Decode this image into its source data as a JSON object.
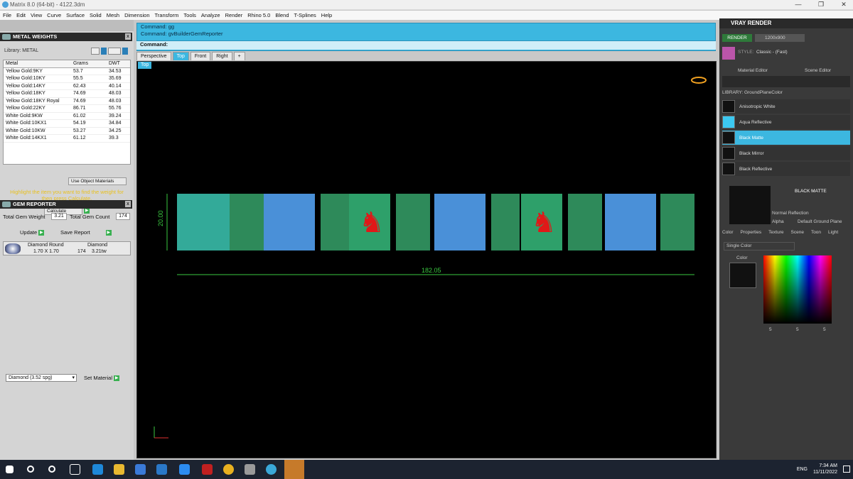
{
  "window": {
    "title": "Matrix 8.0 (64-bit) - 4122.3dm",
    "min": "—",
    "max": "❐",
    "close": "✕"
  },
  "menu": [
    "File",
    "Edit",
    "View",
    "Curve",
    "Surface",
    "Solid",
    "Mesh",
    "Dimension",
    "Transform",
    "Tools",
    "Analyze",
    "Render",
    "Rhino 5.0",
    "Blend",
    "T-Splines",
    "Help"
  ],
  "metal_weights": {
    "title": "METAL WEIGHTS",
    "library_label": "Library: METAL",
    "columns": [
      "Metal",
      "Grams",
      "DWT"
    ],
    "rows": [
      [
        "Yellow Gold:9KY",
        "53.7",
        "34.53"
      ],
      [
        "Yellow Gold:10KY",
        "55.5",
        "35.69"
      ],
      [
        "Yellow Gold:14KY",
        "62.43",
        "40.14"
      ],
      [
        "Yellow Gold:18KY",
        "74.69",
        "48.03"
      ],
      [
        "Yellow Gold:18KY Royal",
        "74.69",
        "48.03"
      ],
      [
        "Yellow Gold:22KY",
        "86.71",
        "55.76"
      ],
      [
        "White Gold:9KW",
        "61.02",
        "39.24"
      ],
      [
        "White Gold:10KX1",
        "54.19",
        "34.84"
      ],
      [
        "White Gold:10KW",
        "53.27",
        "34.25"
      ],
      [
        "White Gold:14KX1",
        "61.12",
        "39.3"
      ]
    ],
    "use_object_materials": "Use Object Materials",
    "hint": "Highlight the item you want to find the weight for then press Calculate.",
    "calculate": "Calculate"
  },
  "gem_reporter": {
    "title": "GEM REPORTER",
    "total_weight_label": "Total Gem Weight",
    "total_weight": "3.21",
    "total_count_label": "Total Gem Count",
    "total_count": "174",
    "update": "Update",
    "save_report": "Save Report",
    "gem_type": "Diamond Round",
    "gem_size": "1.70 X 1.70",
    "gem_material": "Diamond",
    "gem_count": "174",
    "gem_ctw": "3.21tw",
    "material_select": "Diamond   (3.52 spg)",
    "set_material": "Set Material"
  },
  "command": {
    "line1": "Command: gg",
    "line2": "Command: gvBuilderGemReporter",
    "prompt": "Command:"
  },
  "viewport_tabs": [
    "Perspective",
    "Top",
    "Front",
    "Right",
    "+"
  ],
  "viewport_label": "Top",
  "dimensions": {
    "height": "20.00",
    "length": "182.05"
  },
  "vray": {
    "title": "VRAY RENDER",
    "render": "RENDER",
    "resolution": "1200x900",
    "style_label": "STYLE:",
    "style_value": "Classic - (Fast)",
    "tab_material": "Material Editor",
    "tab_scene": "Scene Editor",
    "library": "LIBRARY: GroundPlaneColor",
    "materials": [
      "Anisotropic White",
      "Aqua Reflective",
      "Black Matte",
      "Black Mirror",
      "Black Reflective"
    ],
    "selected_name": "BLACK MATTE",
    "reflection": "Normal Reflection",
    "alpha": "Alpha",
    "ground": "Default Ground Plane",
    "subtabs": [
      "Color",
      "Properties",
      "Texture",
      "Scene",
      "Toon",
      "Light"
    ],
    "color_mode": "Single Color",
    "color_label": "Color",
    "r": "5",
    "g": "5",
    "b": "5"
  },
  "taskbar": {
    "time": "7:34 AM",
    "date": "11/11/2022",
    "lang": "ENG"
  },
  "colors": {
    "accent": "#3cb7e0",
    "band": "#2ea06a",
    "gem": "#4a90d8",
    "figure": "#e01818"
  }
}
